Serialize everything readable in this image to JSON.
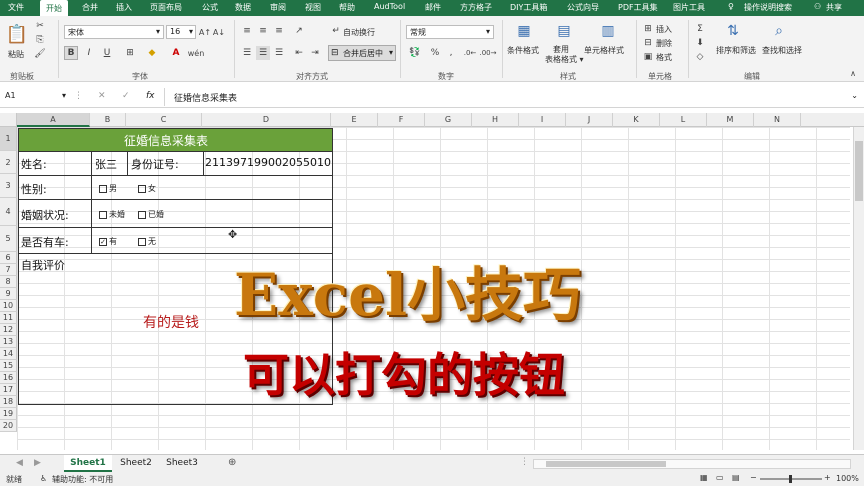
{
  "ribbon_tabs": [
    "文件",
    "开始",
    "合并",
    "插入",
    "页面布局",
    "公式",
    "数据",
    "审阅",
    "视图",
    "帮助",
    "AudTool",
    "邮件",
    "方方格子",
    "DIY工具箱",
    "公式向导",
    "PDF工具集",
    "图片工具"
  ],
  "tell_me": "操作说明搜索",
  "share": "共享",
  "clipboard": {
    "paste": "粘贴",
    "group": "剪贴板"
  },
  "font": {
    "name": "宋体",
    "size": "16",
    "bold": "B",
    "italic": "I",
    "underline": "U",
    "group": "字体"
  },
  "alignment": {
    "wrap": "自动换行",
    "merge": "合并后居中",
    "group": "对齐方式"
  },
  "number": {
    "format": "常规",
    "group": "数字"
  },
  "styles": {
    "conditional": "条件格式",
    "table": "套用\n表格格式",
    "cell": "单元格样式",
    "group": "样式"
  },
  "cells": {
    "insert": "插入",
    "delete": "删除",
    "format": "格式",
    "group": "单元格"
  },
  "editing": {
    "sort": "排序和筛选",
    "find": "查找和选择",
    "group": "编辑"
  },
  "formula_bar": {
    "name_box": "A1",
    "fx": "fx",
    "content": "征婚信息采集表"
  },
  "columns": [
    "A",
    "B",
    "C",
    "D",
    "E",
    "F",
    "G",
    "H",
    "I",
    "J",
    "K",
    "L",
    "M",
    "N"
  ],
  "rows": [
    "1",
    "2",
    "3",
    "4",
    "5",
    "6",
    "7",
    "8",
    "9",
    "10",
    "11",
    "12",
    "13",
    "14",
    "15",
    "16",
    "17",
    "18",
    "19",
    "20"
  ],
  "form": {
    "title": "征婚信息采集表",
    "name_label": "姓名:",
    "name_value": "张三",
    "id_label": "身份证号:",
    "id_value": "211397199002055010",
    "gender_label": "性别:",
    "gender_male": "男",
    "gender_female": "女",
    "marital_label": "婚姻状况:",
    "unmarried": "未婚",
    "married": "已婚",
    "car_label": "是否有车:",
    "car_yes": "有",
    "car_no": "无",
    "self_eval_label": "自我评价",
    "self_eval_text": "有的是钱"
  },
  "overlay": {
    "line1": "Excel小技巧",
    "line2": "可以打勾的按钮"
  },
  "sheets": [
    "Sheet1",
    "Sheet2",
    "Sheet3"
  ],
  "active_sheet": "Sheet1",
  "status": {
    "ready": "就绪",
    "accessibility": "辅助功能: 不可用",
    "zoom": "100%"
  }
}
